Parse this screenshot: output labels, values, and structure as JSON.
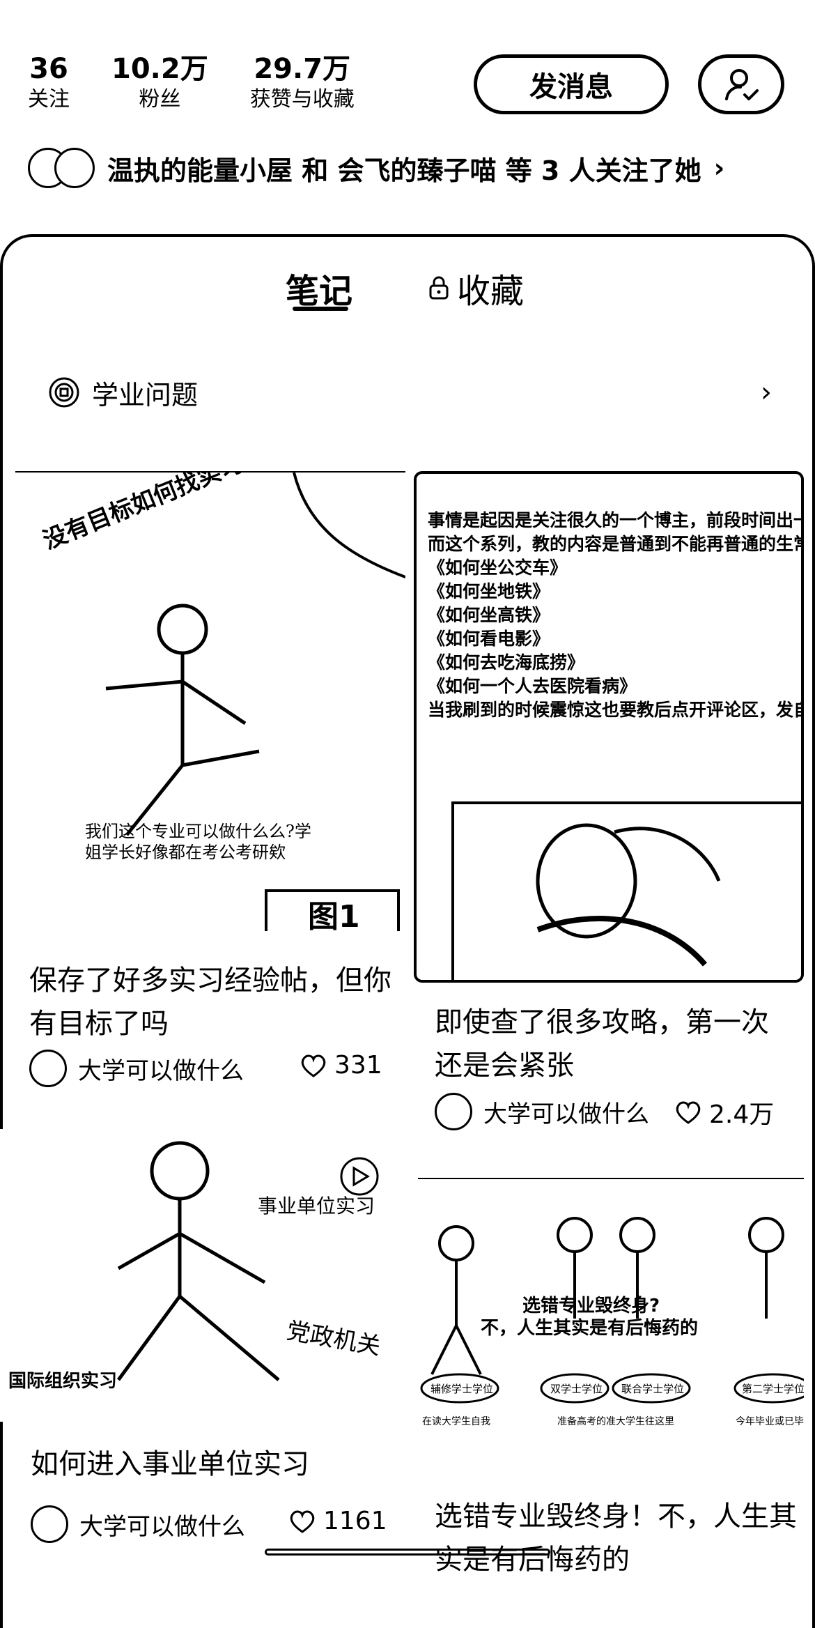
{
  "stats": [
    {
      "value": "36",
      "label": "关注"
    },
    {
      "value": "10.2万",
      "label": "粉丝"
    },
    {
      "value": "29.7万",
      "label": "获赞与收藏"
    }
  ],
  "buttons": {
    "message": "发消息",
    "profile_icon": "user-check-icon"
  },
  "follow_line": {
    "text": "温执的能量小屋 和 会飞的臻子喵 等 3 人关注了她",
    "chevron": "›"
  },
  "tabs": {
    "notes": "笔记",
    "favorites": "收藏",
    "favorites_icon": "lock-icon"
  },
  "album": {
    "label": "学业问题",
    "icon": "album-icon",
    "arrow": "›"
  },
  "cards": [
    {
      "title": "保存了好多实习经验帖，但你有目标了吗",
      "author": "大学可以做什么",
      "likes": "331",
      "image_texts": [
        "没有目标如何找实习",
        "我们这个专业可以做什么么?学姐学长好像都在考公考研欸",
        "图1"
      ]
    },
    {
      "title": "即使查了很多攻略，第一次还是会紧张",
      "author": "大学可以做什么",
      "likes": "2.4万",
      "image_texts": [
        "事情是起因是关注很久的一个博主，前段时间出一个《如何如何》系列，一下子涨粉近百万。",
        "而这个系列，教的内容是普通到不能再普通的生常识，即：",
        "《如何坐公交车》",
        "《如何坐地铁》",
        "《如何坐高铁》",
        "《如何看电影》",
        "《如何去吃海底捞》",
        "《如何一个人去医院看病》",
        "当我刷到的时候震惊这也要教后点开评论区，发自己也成了那个\"何不食肉糜\"的高傲的\"城市人\""
      ]
    },
    {
      "title": "如何进入事业单位实习",
      "author": "大学可以做什么",
      "likes": "1161",
      "image_texts": [
        "事业单位实习",
        "党政机关",
        "国际组织实习"
      ]
    },
    {
      "title": "选错专业毁终身！不，人生其实是有后悔药的",
      "author": "",
      "likes": "",
      "image_texts": [
        "选错专业毁终身?",
        "不，人生其实是有后悔药的",
        "辅修学士学位",
        "双学士学位",
        "联合学士学位",
        "第二学士学位",
        "在读大学生自我",
        "准备高考的准大学生往这里",
        "今年毕业或已毕"
      ]
    }
  ],
  "icons": {
    "heart": "heart-icon"
  }
}
